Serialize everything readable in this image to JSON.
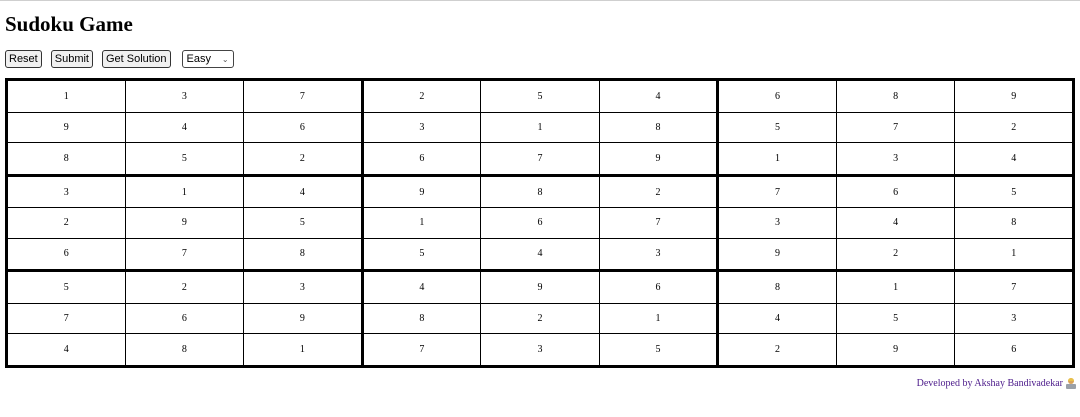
{
  "title": "Sudoku Game",
  "controls": {
    "reset_label": "Reset",
    "submit_label": "Submit",
    "solution_label": "Get Solution",
    "difficulty_selected": "Easy"
  },
  "grid": [
    [
      1,
      3,
      7,
      2,
      5,
      4,
      6,
      8,
      9
    ],
    [
      9,
      4,
      6,
      3,
      1,
      8,
      5,
      7,
      2
    ],
    [
      8,
      5,
      2,
      6,
      7,
      9,
      1,
      3,
      4
    ],
    [
      3,
      1,
      4,
      9,
      8,
      2,
      7,
      6,
      5
    ],
    [
      2,
      9,
      5,
      1,
      6,
      7,
      3,
      4,
      8
    ],
    [
      6,
      7,
      8,
      5,
      4,
      3,
      9,
      2,
      1
    ],
    [
      5,
      2,
      3,
      4,
      9,
      6,
      8,
      1,
      7
    ],
    [
      7,
      6,
      9,
      8,
      2,
      1,
      4,
      5,
      3
    ],
    [
      4,
      8,
      1,
      7,
      3,
      5,
      2,
      9,
      6
    ]
  ],
  "footer": {
    "credit": "Developed by Akshay Bandivadekar",
    "icon": "technologist-icon",
    "color": "#4b1a8a"
  }
}
